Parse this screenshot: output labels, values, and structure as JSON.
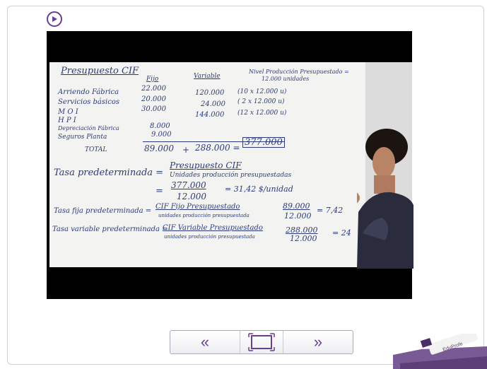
{
  "player": {
    "play_icon": "play-circle-icon",
    "accent": "#6a3f8f"
  },
  "whiteboard": {
    "title": "Presupuesto CIF",
    "col_fijo": "Fijo",
    "col_variable": "Variable",
    "nivel_line1": "Nivel Producción Presupuestado =",
    "nivel_line2": "12.000 unidades",
    "rows": [
      {
        "label": "Arriendo Fábrica",
        "fijo": "22.000",
        "variable": "120.000",
        "note": "(10 x 12.000 u)"
      },
      {
        "label": "Servicios básicos",
        "fijo": "20.000",
        "variable": "24.000",
        "note": "( 2 x 12.000 u)"
      },
      {
        "label": "M O I",
        "fijo": "30.000",
        "variable": "144.000",
        "note": "(12 x 12.000 u)"
      },
      {
        "label": "H P I",
        "fijo": "",
        "variable": "",
        "note": ""
      },
      {
        "label": "Depreciación Fábrica",
        "fijo": "8.000",
        "variable": "",
        "note": ""
      },
      {
        "label": "Seguros Planta",
        "fijo": "9.000",
        "variable": "",
        "note": ""
      }
    ],
    "total_label": "TOTAL",
    "total_fijo": "89.000",
    "plus": "+",
    "total_variable": "288.000 =",
    "total_sum": "377.000",
    "tasa_label": "Tasa predeterminada =",
    "tasa_num": "Presupuesto CIF",
    "tasa_den": "Unidades producción presupuestadas",
    "tasa_eq": "=",
    "tasa_val_num": "377.000",
    "tasa_val_den": "12.000",
    "tasa_result": "= 31,42 $/unidad",
    "fija_label": "Tasa fija predeterminada =",
    "fija_num": "CIF Fijo Presupuestado",
    "fija_den": "unidades producción presupuestada",
    "fija_val_num": "89.000",
    "fija_val_den": "12.000",
    "fija_result": "= 7,42",
    "var_label": "Tasa variable predeterminada =",
    "var_num": "CIF Variable Presupuestado",
    "var_den": "unidades producción presupuestada",
    "var_val_num": "288.000",
    "var_val_den": "12.000",
    "var_result": "= 24"
  },
  "nav": {
    "prev_label": "«",
    "next_label": "»",
    "fullscreen_icon": "fullscreen-frame-icon"
  },
  "brand": {
    "logo_text": "EduProfe"
  }
}
